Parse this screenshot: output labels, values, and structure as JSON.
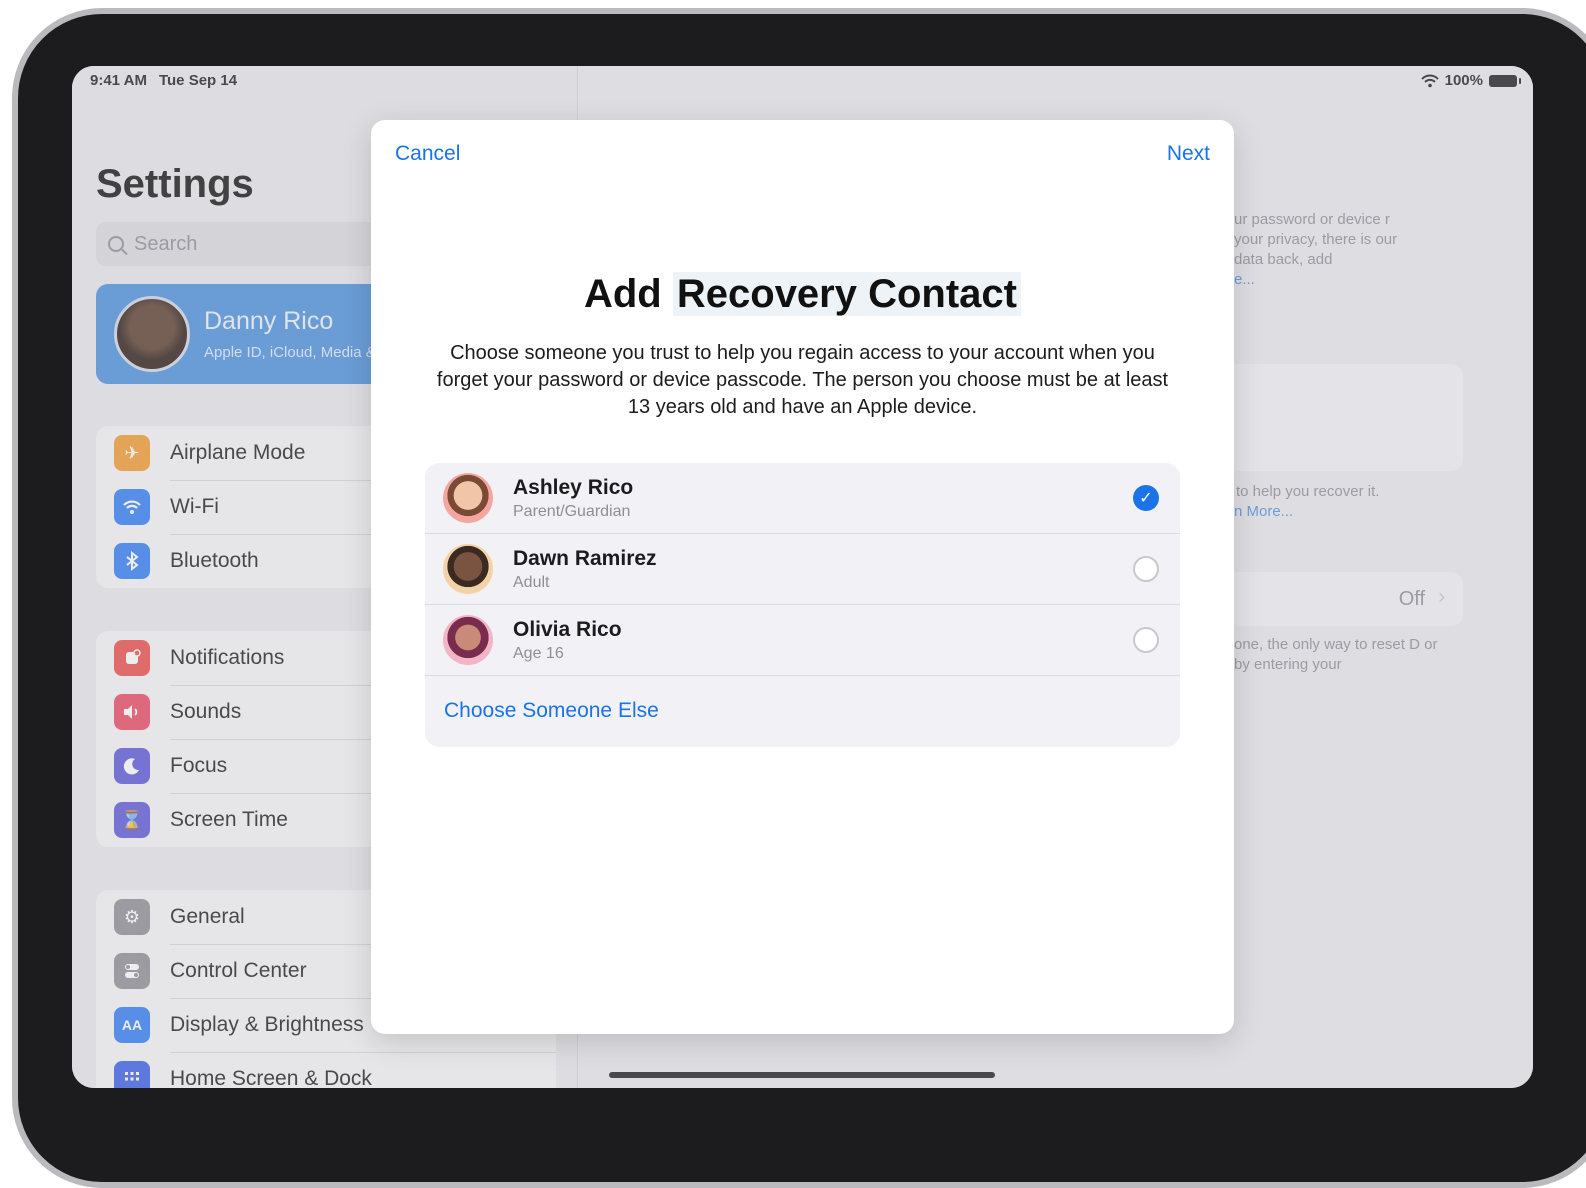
{
  "status_bar": {
    "time": "9:41 AM",
    "date": "Tue Sep 14",
    "battery": "100%"
  },
  "sidebar": {
    "title": "Settings",
    "search_placeholder": "Search",
    "profile": {
      "name": "Danny Rico",
      "subtitle": "Apple ID, iCloud, Media & Purchases"
    },
    "groups": [
      [
        {
          "label": "Airplane Mode",
          "icon": "airplane-icon",
          "color": "#f29a2e"
        },
        {
          "label": "Wi-Fi",
          "icon": "wifi-icon",
          "color": "#2f7cf6"
        },
        {
          "label": "Bluetooth",
          "icon": "bluetooth-icon",
          "color": "#2f7cf6"
        }
      ],
      [
        {
          "label": "Notifications",
          "icon": "notifications-icon",
          "color": "#ec4c47"
        },
        {
          "label": "Sounds",
          "icon": "sounds-icon",
          "color": "#ea4862"
        },
        {
          "label": "Focus",
          "icon": "moon-icon",
          "color": "#5b57d9"
        },
        {
          "label": "Screen Time",
          "icon": "hourglass-icon",
          "color": "#5b57d9"
        }
      ],
      [
        {
          "label": "General",
          "icon": "gear-icon",
          "color": "#8e8e93"
        },
        {
          "label": "Control Center",
          "icon": "toggles-icon",
          "color": "#8e8e93"
        },
        {
          "label": "Display & Brightness",
          "icon": "aa-icon",
          "color": "#2f7cf6"
        },
        {
          "label": "Home Screen & Dock",
          "icon": "home-grid-icon",
          "color": "#3a5ee6"
        }
      ]
    ]
  },
  "detail_background": {
    "text1": "ur password or device r your privacy, there is our data back, add",
    "link1": "e...",
    "text2": "to help you recover it.",
    "link2": "n More...",
    "off_value": "Off",
    "text3": "one, the only way to reset D or by entering your"
  },
  "modal": {
    "cancel": "Cancel",
    "next": "Next",
    "title_part1": "Add",
    "title_part2": "Recovery Contact",
    "description": "Choose someone you trust to help you regain access to your account when you forget your password or device passcode. The person you choose must be at least 13 years old and have an Apple device.",
    "contacts": [
      {
        "name": "Ashley Rico",
        "relation": "Parent/Guardian",
        "selected": true
      },
      {
        "name": "Dawn Ramirez",
        "relation": "Adult",
        "selected": false
      },
      {
        "name": "Olivia Rico",
        "relation": "Age 16",
        "selected": false
      }
    ],
    "choose_else": "Choose Someone Else"
  },
  "colors": {
    "accent": "#1a73e8",
    "profile_bg": "#4a8fdd"
  }
}
